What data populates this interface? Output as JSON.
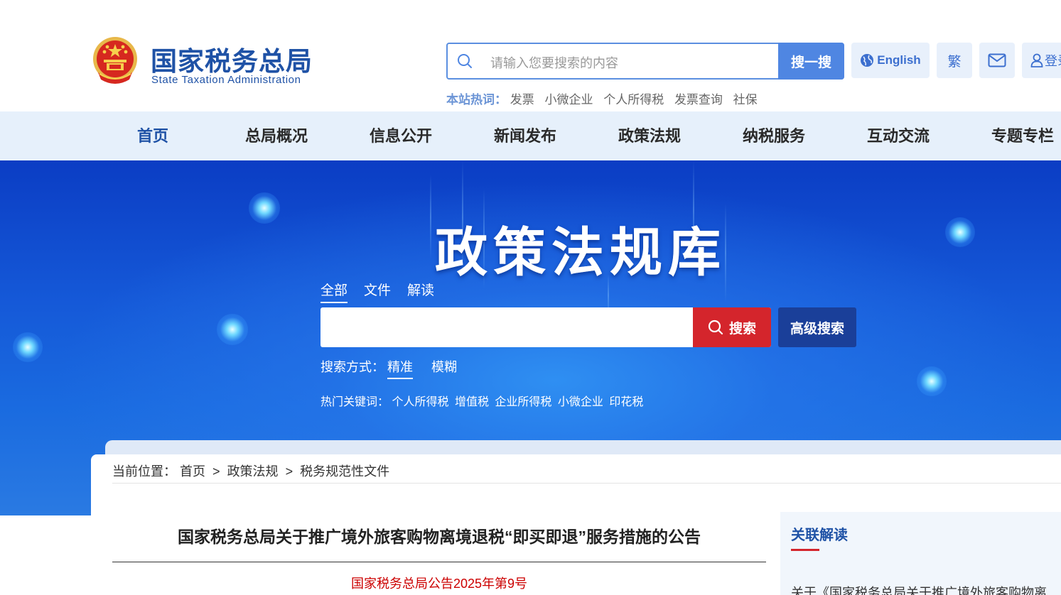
{
  "header": {
    "title": "国家税务总局",
    "subtitle": "State Taxation Administration",
    "search_placeholder": "请输入您要搜索的内容",
    "search_button": "搜一搜",
    "english": "English",
    "traditional": "繁",
    "login": "登录",
    "hot_label": "本站热词：",
    "hot_words": [
      "发票",
      "小微企业",
      "个人所得税",
      "发票查询",
      "社保"
    ]
  },
  "nav": {
    "items": [
      "首页",
      "总局概况",
      "信息公开",
      "新闻发布",
      "政策法规",
      "纳税服务",
      "互动交流",
      "专题专栏"
    ]
  },
  "banner": {
    "title": "政策法规库",
    "tabs": [
      "全部",
      "文件",
      "解读"
    ],
    "search_button": "搜索",
    "advanced_button": "高级搜索",
    "mode_label": "搜索方式：",
    "modes": [
      "精准",
      "模糊"
    ],
    "hot_label": "热门关键词：",
    "hot_words": [
      "个人所得税",
      "增值税",
      "企业所得税",
      "小微企业",
      "印花税"
    ]
  },
  "breadcrumb": {
    "label": "当前位置：",
    "items": [
      "首页",
      ">",
      "政策法规",
      ">",
      "税务规范性文件"
    ]
  },
  "article": {
    "title": "国家税务总局关于推广境外旅客购物离境退税“即买即退”服务措施的公告",
    "doc_number": "国家税务总局公告2025年第9号"
  },
  "related": {
    "title": "关联解读",
    "first_item": "关于《国家税务总局关于推广境外旅客购物离"
  },
  "colors": {
    "brand_blue": "#1f52a6",
    "search_red": "#d4252c",
    "nav_bg": "#e6f0fb"
  }
}
